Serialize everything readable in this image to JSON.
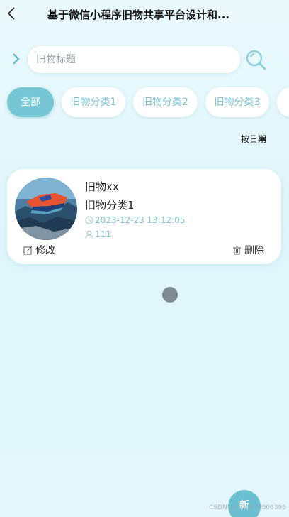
{
  "header": {
    "title": "基于微信小程序旧物共享平台设计和...",
    "back_icon": "chevron-left-icon"
  },
  "search": {
    "placeholder": "旧物标题",
    "value": "",
    "button_icon": "search-icon"
  },
  "categories": [
    {
      "label": "全部",
      "active": true
    },
    {
      "label": "旧物分类1",
      "active": false
    },
    {
      "label": "旧物分类2",
      "active": false
    },
    {
      "label": "旧物分类3",
      "active": false
    }
  ],
  "sort": {
    "label": "按日期",
    "direction": "ascending"
  },
  "items": [
    {
      "name": "旧物xx",
      "category": "旧物分类1",
      "date": "2023-12-23 13:12:05",
      "views": "111",
      "edit_label": "修改",
      "delete_label": "删除"
    }
  ],
  "fab": {
    "label": "新"
  },
  "watermark": "CSDN @QQ1879806396",
  "colors": {
    "accent": "#76c6d4",
    "text_accent": "#7cc6d3",
    "background": "#e2f6fb"
  }
}
